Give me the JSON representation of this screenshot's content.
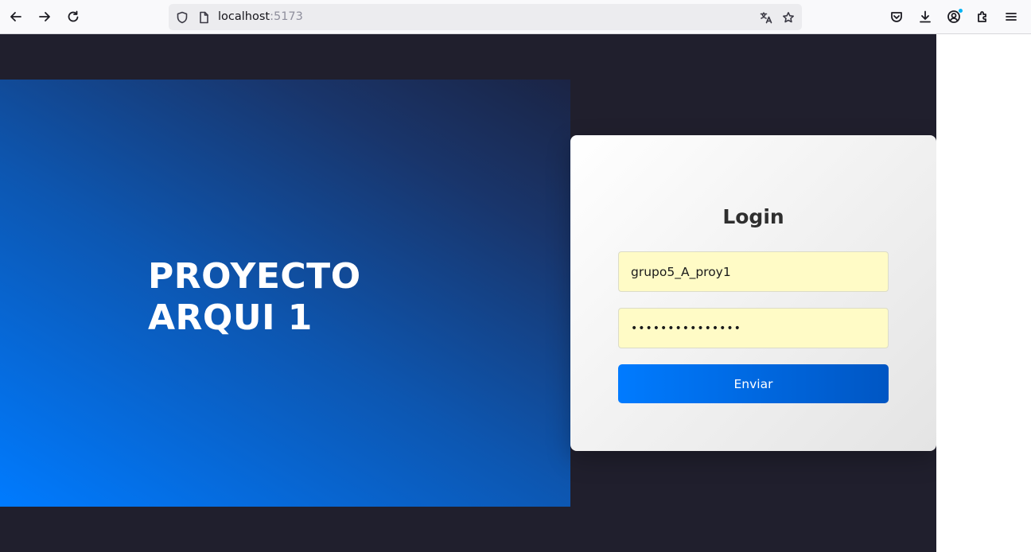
{
  "browser": {
    "url_host": "localhost",
    "url_port": ":5173",
    "icons": {
      "back": "back-arrow-icon",
      "forward": "forward-arrow-icon",
      "reload": "reload-icon",
      "shield": "tracking-shield-icon",
      "page": "page-info-icon",
      "translate": "translate-icon",
      "bookmark": "bookmark-star-icon",
      "pocket": "pocket-icon",
      "downloads": "download-icon",
      "account": "account-icon",
      "extensions": "extensions-icon",
      "menu": "hamburger-menu-icon"
    },
    "notification_color": "#00b3f4"
  },
  "hero": {
    "title_line1": "PROYECTO",
    "title_line2": "ARQUI 1",
    "gradient_from": "#007bff",
    "gradient_to": "#1b2444"
  },
  "login": {
    "title": "Login",
    "username_value": "grupo5_A_proy1",
    "password_value": "•••••••••••••••",
    "submit_label": "Enviar",
    "field_bg": "#fffbc6",
    "button_color": "#007bff"
  },
  "page_background": "#201f2d"
}
